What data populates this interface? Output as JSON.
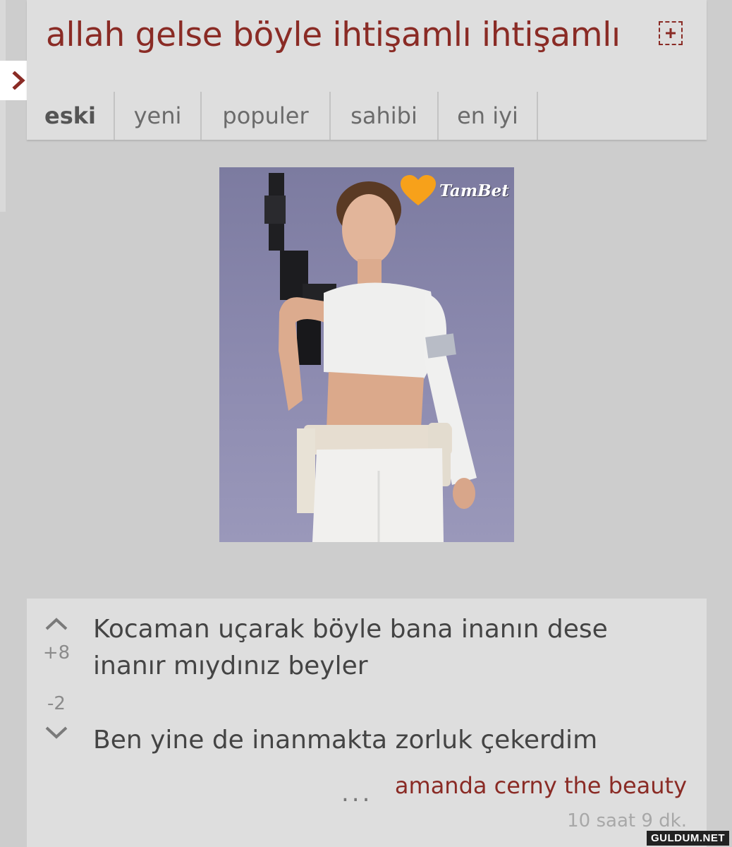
{
  "topic": {
    "title": "allah gelse böyle ihtişamlı ihtişamlı"
  },
  "tabs": [
    {
      "label": "eski",
      "active": true
    },
    {
      "label": "yeni",
      "active": false
    },
    {
      "label": "populer",
      "active": false
    },
    {
      "label": "sahibi",
      "active": false
    },
    {
      "label": "en iyi",
      "active": false
    }
  ],
  "image": {
    "badge_text": "TamBet",
    "badge_color": "#f7a11a"
  },
  "entry": {
    "upvotes": "+8",
    "downvotes": "-2",
    "paragraph_1": "Kocaman uçarak böyle bana inanın dese inanır mıydınız beyler",
    "paragraph_2": "Ben yine de inanmakta zorluk çekerdim",
    "more": "...",
    "author": "amanda cerny the beauty",
    "time": "10 saat 9 dk."
  },
  "watermark": "GULDUM.NET",
  "colors": {
    "accent": "#8a2b25",
    "background": "#cdcdcd",
    "card": "#dedede"
  }
}
